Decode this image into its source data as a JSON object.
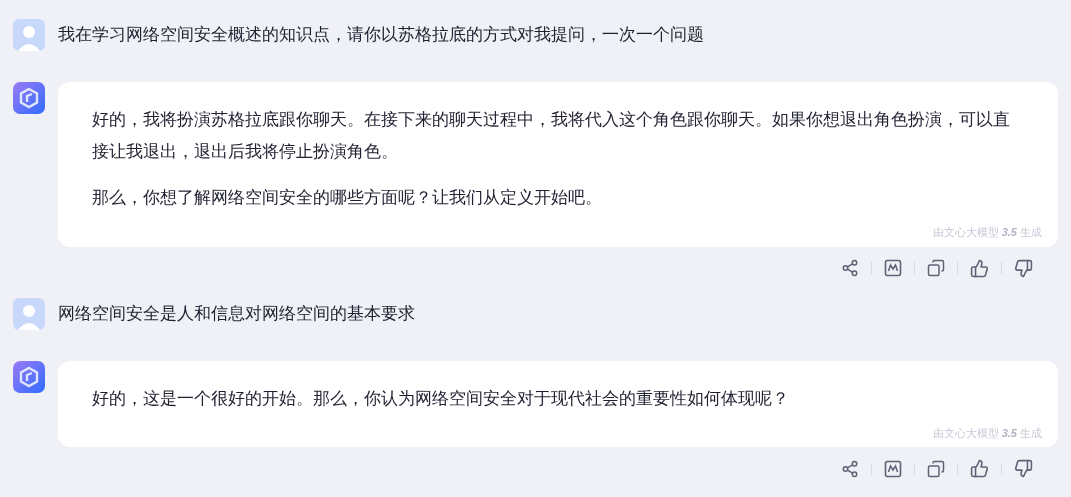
{
  "messages": [
    {
      "kind": "user",
      "text": "我在学习网络空间安全概述的知识点，请你以苏格拉底的方式对我提问，一次一个问题"
    },
    {
      "kind": "bot",
      "paragraphs": [
        "好的，我将扮演苏格拉底跟你聊天。在接下来的聊天过程中，我将代入这个角色跟你聊天。如果你想退出角色扮演，可以直接让我退出，退出后我将停止扮演角色。",
        "那么，你想了解网络空间安全的哪些方面呢？让我们从定义开始吧。"
      ],
      "footer": "由文心大模型 **3.5** 生成"
    },
    {
      "kind": "user",
      "text": "网络空间安全是人和信息对网络空间的基本要求"
    },
    {
      "kind": "bot",
      "paragraphs": [
        "好的，这是一个很好的开始。那么，你认为网络空间安全对于现代社会的重要性如何体现呢？"
      ],
      "footer": "由文心大模型 **3.5** 生成"
    }
  ]
}
